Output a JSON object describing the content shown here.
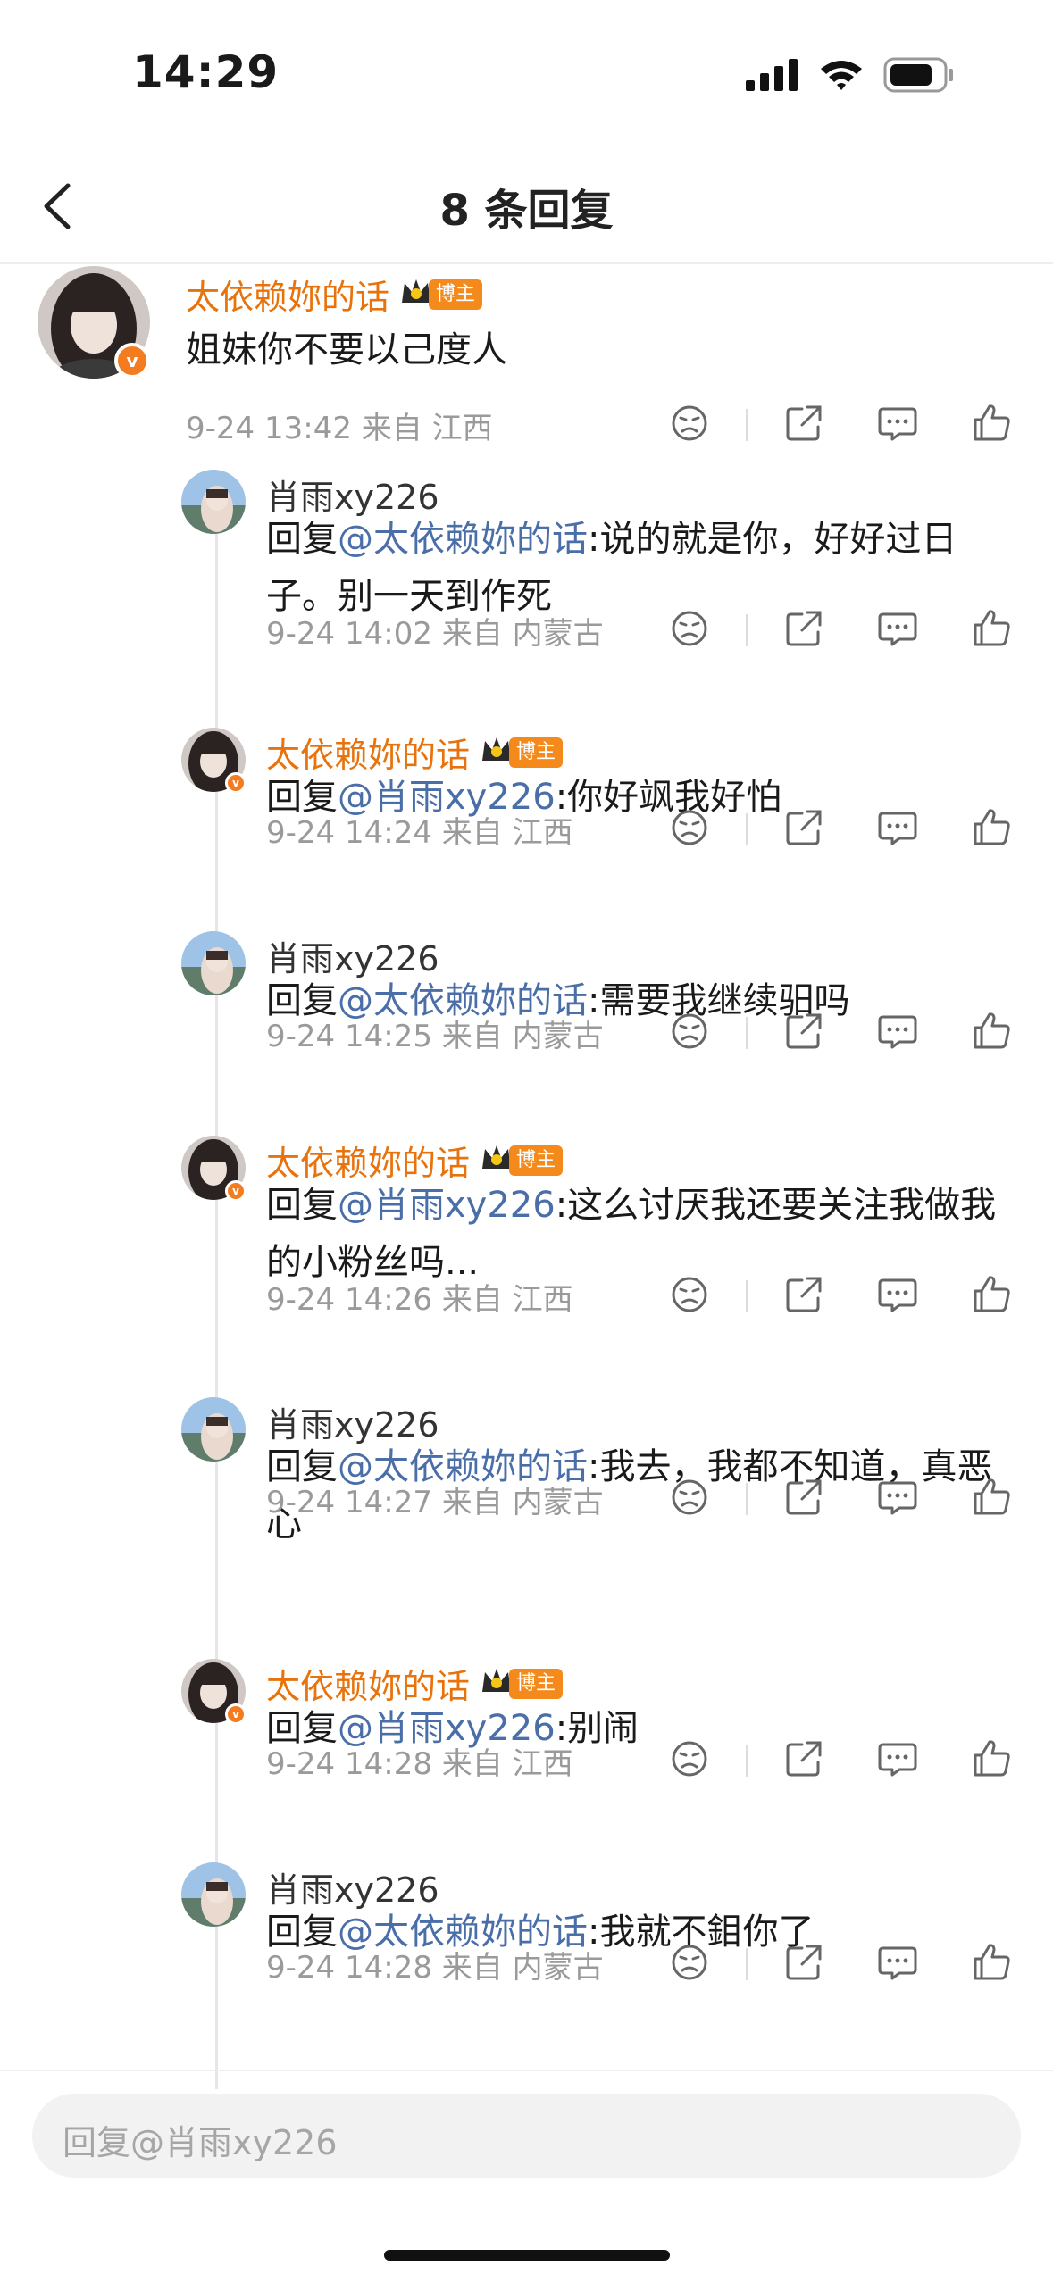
{
  "status": {
    "time": "14:29"
  },
  "header": {
    "title": "8 条回复"
  },
  "main_comment": {
    "author": "太依赖妳的话",
    "badge": "博主",
    "text": "姐妹你不要以己度人",
    "meta": "9-24 13:42  来自 江西"
  },
  "replies": [
    {
      "author": "肖雨xy226",
      "is_host": false,
      "prefix": "回复",
      "mention": "@太依赖妳的话",
      "text": ":说的就是你，好好过日子。别一天到作死",
      "meta": "9-24 14:02  来自 内蒙古"
    },
    {
      "author": "太依赖妳的话",
      "is_host": true,
      "badge": "博主",
      "prefix": "回复",
      "mention": "@肖雨xy226",
      "text": ":你好飒我好怕",
      "meta": "9-24 14:24  来自 江西"
    },
    {
      "author": "肖雨xy226",
      "is_host": false,
      "prefix": "回复",
      "mention": "@太依赖妳的话",
      "text": ":需要我继续驲吗",
      "meta": "9-24 14:25  来自 内蒙古"
    },
    {
      "author": "太依赖妳的话",
      "is_host": true,
      "badge": "博主",
      "prefix": "回复",
      "mention": "@肖雨xy226",
      "text": ":这么讨厌我还要关注我做我的小粉丝吗...",
      "meta": "9-24 14:26  来自 江西"
    },
    {
      "author": "肖雨xy226",
      "is_host": false,
      "prefix": "回复",
      "mention": "@太依赖妳的话",
      "text": ":我去，我都不知道，真恶心",
      "meta": "9-24 14:27  来自 内蒙古"
    },
    {
      "author": "太依赖妳的话",
      "is_host": true,
      "badge": "博主",
      "prefix": "回复",
      "mention": "@肖雨xy226",
      "text": ":别闹",
      "meta": "9-24 14:28  来自 江西"
    },
    {
      "author": "肖雨xy226",
      "is_host": false,
      "prefix": "回复",
      "mention": "@太依赖妳的话",
      "text": ":我就不鉬你了",
      "meta": "9-24 14:28  来自 内蒙古"
    }
  ],
  "reply_input": {
    "placeholder": "回复@肖雨xy226"
  },
  "colors": {
    "host_name": "#e8730c",
    "mention": "#4a6ea8",
    "badge": "#f48a1c"
  },
  "icons": [
    "back-arrow-icon",
    "dislike-face-icon",
    "share-icon",
    "comment-icon",
    "like-thumb-icon"
  ]
}
